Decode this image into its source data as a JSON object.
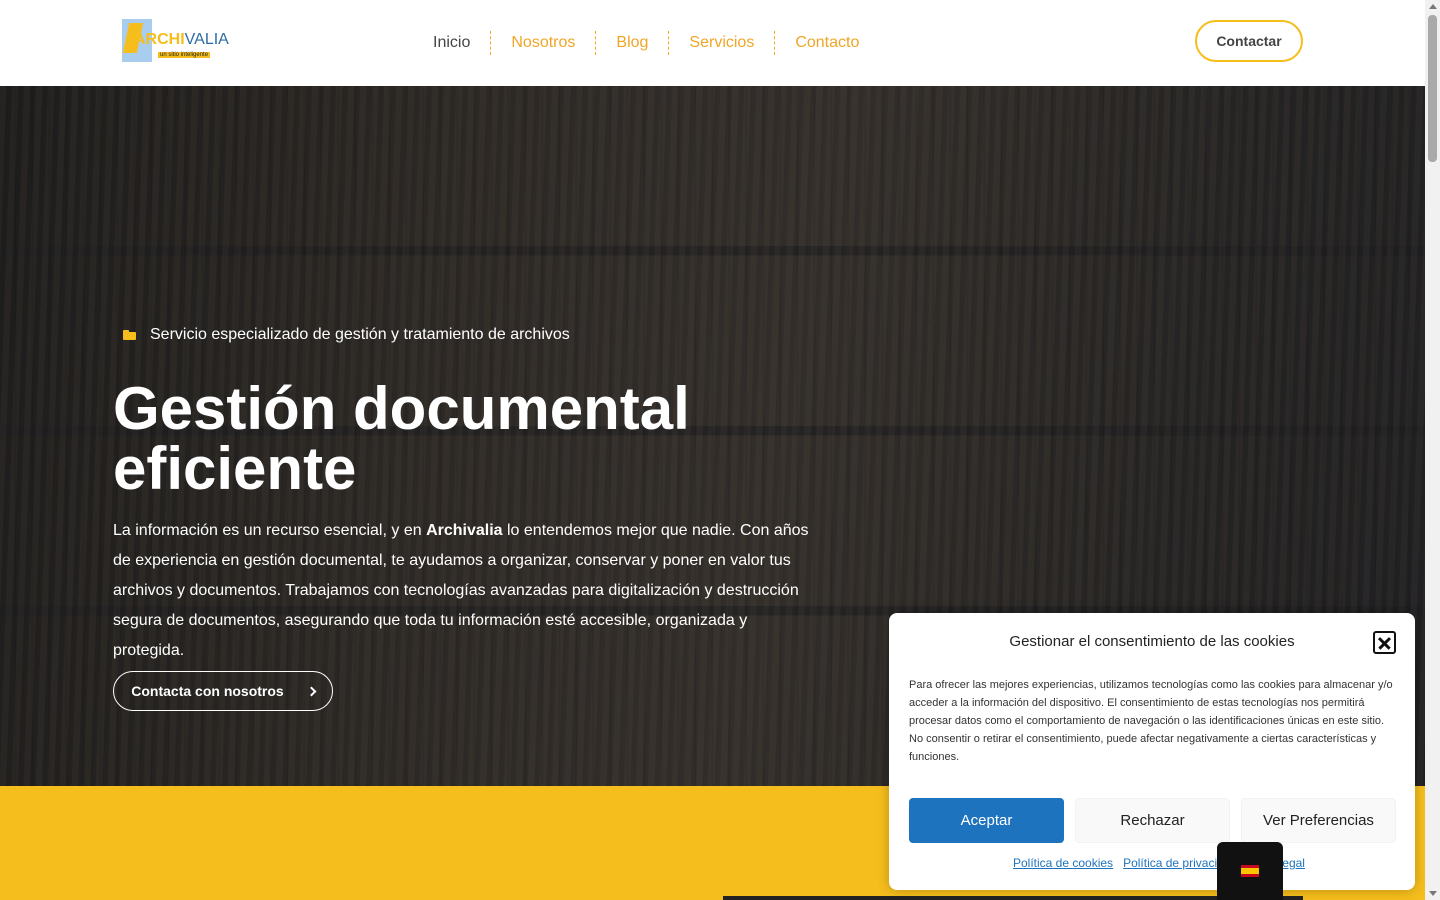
{
  "header": {
    "logo": {
      "word_a": "ARCHI",
      "word_b": "VALIA",
      "tagline": "un sitio inteligente"
    },
    "nav": [
      "Inicio",
      "Nosotros",
      "Blog",
      "Servicios",
      "Contacto"
    ],
    "cta_label": "Contactar"
  },
  "hero": {
    "eyebrow": "Servicio especializado de gestión y tratamiento de archivos",
    "title": "Gestión documental eficiente",
    "text_pre": " La información es un recurso esencial, y en ",
    "text_bold": "Archivalia",
    "text_post": " lo entendemos mejor que nadie. Con años de experiencia en gestión documental, te ayudamos a organizar, conservar y poner en valor tus archivos y documentos. Trabajamos con tecnologías avanzadas para digitalización y destrucción segura de documentos, asegurando que toda tu información esté accesible, organizada y protegida.",
    "button_label": "Contacta con nosotros"
  },
  "cookie": {
    "title": "Gestionar el consentimiento de las cookies",
    "body": "Para ofrecer las mejores experiencias, utilizamos tecnologías como las cookies para almacenar y/o acceder a la información del dispositivo. El consentimiento de estas tecnologías nos permitirá procesar datos como el comportamiento de navegación o las identificaciones únicas en este sitio. No consentir o retirar el consentimiento, puede afectar negativamente a ciertas características y funciones.",
    "accept": "Aceptar",
    "reject": "Rechazar",
    "preferences": "Ver Preferencias",
    "links": [
      "Política de cookies",
      "Política de privacidad",
      "Aviso legal"
    ]
  },
  "colors": {
    "accent": "#f6be1c",
    "primary_button": "#1e73be",
    "nav_link": "#f0a626"
  },
  "icons": {
    "eyebrow": "folder-open-icon",
    "button": "chevron-right-icon",
    "close": "close-icon",
    "language": "spain-flag-icon"
  }
}
